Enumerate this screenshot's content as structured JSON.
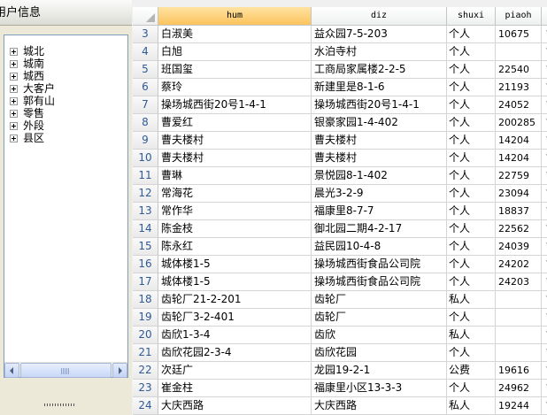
{
  "panel": {
    "title": "用户信息",
    "tree_items": [
      "城北",
      "城南",
      "城西",
      "大客户",
      "郭有山",
      "零售",
      "外段",
      "县区"
    ]
  },
  "grid": {
    "columns": [
      "hum",
      "diz",
      "shuxi",
      "piaoh"
    ],
    "selected_column": "hum",
    "rows": [
      {
        "n": "3",
        "hum": "白淑美",
        "diz": "益众园7-5-203",
        "shuxi": "个人",
        "piaoh": "10675",
        "extra": "プ"
      },
      {
        "n": "4",
        "hum": "白旭",
        "diz": "水泊寺村",
        "shuxi": "个人",
        "piaoh": "",
        "extra": "プ"
      },
      {
        "n": "5",
        "hum": "班国玺",
        "diz": "工商局家属楼2-2-5",
        "shuxi": "个人",
        "piaoh": "22540",
        "extra": "プ"
      },
      {
        "n": "6",
        "hum": "蔡玲",
        "diz": "新建里是8-1-6",
        "shuxi": "个人",
        "piaoh": "21193",
        "extra": "プ"
      },
      {
        "n": "7",
        "hum": "操场城西街20号1-4-1",
        "diz": "操场城西街20号1-4-1",
        "shuxi": "个人",
        "piaoh": "24052",
        "extra": "プ"
      },
      {
        "n": "8",
        "hum": "曹爱红",
        "diz": "银豪家园1-4-402",
        "shuxi": "个人",
        "piaoh": "200285",
        "extra": "プ"
      },
      {
        "n": "9",
        "hum": "曹夫楼村",
        "diz": "曹夫楼村",
        "shuxi": "个人",
        "piaoh": "14204",
        "extra": "プ"
      },
      {
        "n": "10",
        "hum": "曹夫楼村",
        "diz": "曹夫楼村",
        "shuxi": "个人",
        "piaoh": "14204",
        "extra": "プ"
      },
      {
        "n": "11",
        "hum": "曹琳",
        "diz": "景悦园8-1-402",
        "shuxi": "个人",
        "piaoh": "22759",
        "extra": "プ"
      },
      {
        "n": "12",
        "hum": "常海花",
        "diz": "晨光3-2-9",
        "shuxi": "个人",
        "piaoh": "23094",
        "extra": "プ"
      },
      {
        "n": "13",
        "hum": "常作华",
        "diz": "福康里8-7-7",
        "shuxi": "个人",
        "piaoh": "18837",
        "extra": "プ"
      },
      {
        "n": "14",
        "hum": "陈金枝",
        "diz": "御北园二期4-2-17",
        "shuxi": "个人",
        "piaoh": "22562",
        "extra": "プ"
      },
      {
        "n": "15",
        "hum": "陈永红",
        "diz": "益民园10-4-8",
        "shuxi": "个人",
        "piaoh": "24039",
        "extra": "プ"
      },
      {
        "n": "16",
        "hum": "城体楼1-5",
        "diz": "操场城西街食品公司院",
        "shuxi": "个人",
        "piaoh": "24202",
        "extra": "プ"
      },
      {
        "n": "17",
        "hum": "城体楼1-5",
        "diz": "操场城西街食品公司院",
        "shuxi": "个人",
        "piaoh": "24203",
        "extra": "プ"
      },
      {
        "n": "18",
        "hum": "齿轮厂21-2-201",
        "diz": "齿轮厂",
        "shuxi": "私人",
        "piaoh": "",
        "extra": "プ"
      },
      {
        "n": "19",
        "hum": "齿轮厂3-2-401",
        "diz": "齿轮厂",
        "shuxi": "个人",
        "piaoh": "",
        "extra": "プ"
      },
      {
        "n": "20",
        "hum": "齿欣1-3-4",
        "diz": "齿欣",
        "shuxi": "私人",
        "piaoh": "",
        "extra": "プ"
      },
      {
        "n": "21",
        "hum": "齿欣花园2-3-4",
        "diz": "齿欣花园",
        "shuxi": "个人",
        "piaoh": "",
        "extra": "プ"
      },
      {
        "n": "22",
        "hum": "次廷广",
        "diz": "龙园19-2-1",
        "shuxi": "公费",
        "piaoh": "19616",
        "extra": "プ"
      },
      {
        "n": "23",
        "hum": "崔金柱",
        "diz": "福康里小区13-3-3",
        "shuxi": "个人",
        "piaoh": "24962",
        "extra": "プ"
      },
      {
        "n": "24",
        "hum": "大庆西路",
        "diz": "大庆西路",
        "shuxi": "私人",
        "piaoh": "19244",
        "extra": "プ"
      }
    ]
  },
  "icons": {
    "tree_expander": "plus-box-icon",
    "scroll_left": "arrow-left-icon",
    "scroll_right": "arrow-right-icon",
    "corner": "select-all-triangle-icon"
  }
}
